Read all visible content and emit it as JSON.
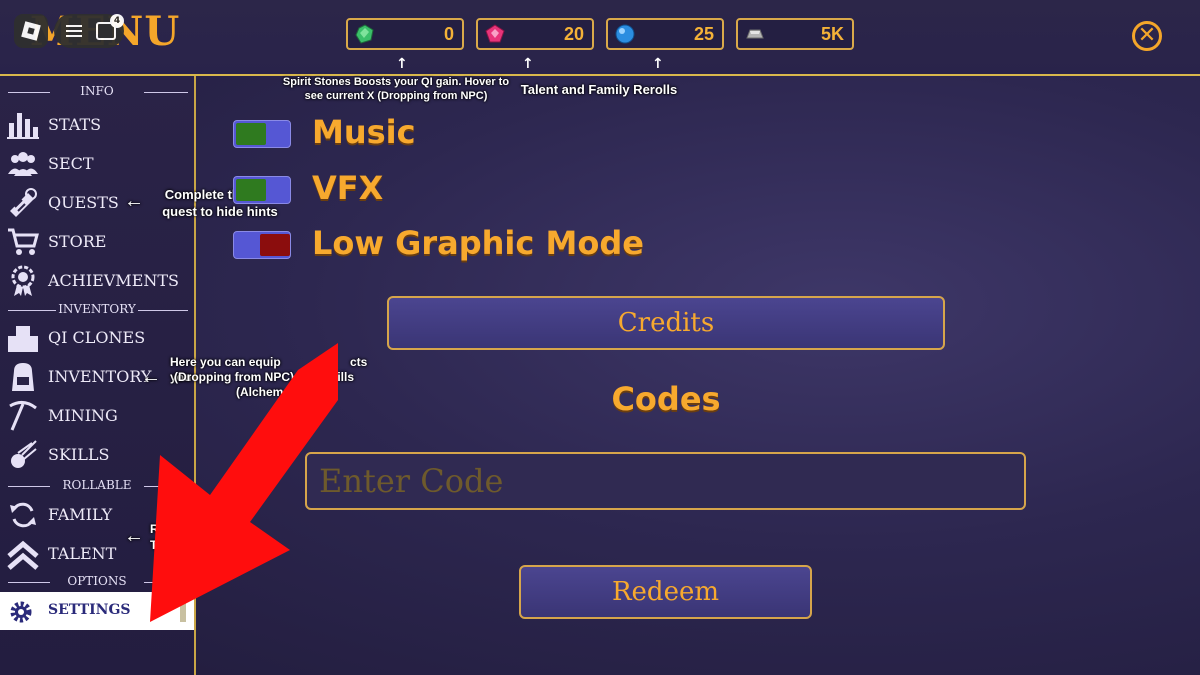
{
  "app": {
    "title": "MENU"
  },
  "roblox": {
    "notification_count": "4"
  },
  "currencies": [
    {
      "icon": "spirit-stone-icon",
      "value": "0",
      "color": "#3bbf6a"
    },
    {
      "icon": "talent-gem-icon",
      "value": "20",
      "color": "#e8347a"
    },
    {
      "icon": "family-orb-icon",
      "value": "25",
      "color": "#2b8de0"
    },
    {
      "icon": "silver-ingot-icon",
      "value": "5K",
      "color": "#b5b5b5"
    }
  ],
  "hints": {
    "spirit_stones": "Spirit Stones Boosts your QI gain. Hover to see current X (Dropping from NPC)",
    "rerolls": "Talent and Family Rerolls",
    "quests": "Complete the first quest to hide hints",
    "inventory_line1": "Here you can equip you",
    "inventory_line1b": "cts",
    "inventory_line2": "(Dropping from NPC)",
    "inventory_line2b": "pills",
    "inventory_line3": "(Alchem",
    "rollable_line1": "R",
    "rollable_line2": "T"
  },
  "sidebar": {
    "sections": {
      "info": "INFO",
      "inventory": "INVENTORY",
      "rollable": "ROLLABLE",
      "options": "OPTIONS"
    },
    "items": [
      {
        "label": "STATS",
        "icon": "stats-bars-icon"
      },
      {
        "label": "SECT",
        "icon": "people-icon"
      },
      {
        "label": "QUESTS",
        "icon": "scroll-icon"
      },
      {
        "label": "STORE",
        "icon": "cart-icon"
      },
      {
        "label": "ACHIEVMENTS",
        "icon": "medal-gear-icon"
      },
      {
        "label": "QI CLONES",
        "icon": "clones-icon"
      },
      {
        "label": "INVENTORY",
        "icon": "backpack-icon"
      },
      {
        "label": "MINING",
        "icon": "pickaxe-icon"
      },
      {
        "label": "SKILLS",
        "icon": "meteor-icon"
      },
      {
        "label": "FAMILY",
        "icon": "refresh-icon"
      },
      {
        "label": "TALENT",
        "icon": "chevrons-up-icon"
      },
      {
        "label": "SETTINGS",
        "icon": "gear-icon"
      }
    ]
  },
  "settings": {
    "toggles": [
      {
        "label": "Music",
        "state": "on",
        "on_color": "#2f7a1f"
      },
      {
        "label": "VFX",
        "state": "on",
        "on_color": "#2f7a1f"
      },
      {
        "label": "Low Graphic Mode",
        "state": "off",
        "off_color": "#8b0d0d"
      }
    ],
    "credits_label": "Credits",
    "codes_title": "Codes",
    "code_placeholder": "Enter Code",
    "redeem_label": "Redeem"
  },
  "accent_color": "#f7a92e"
}
